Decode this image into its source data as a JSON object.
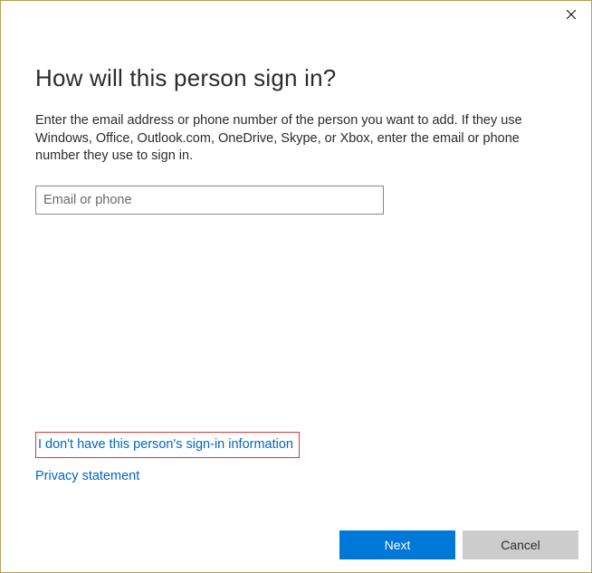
{
  "heading": "How will this person sign in?",
  "description": "Enter the email address or phone number of the person you want to add. If they use Windows, Office, Outlook.com, OneDrive, Skype, or Xbox, enter the email or phone number they use to sign in.",
  "email_input": {
    "placeholder": "Email or phone",
    "value": ""
  },
  "links": {
    "no_info": "I don't have this person's sign-in information",
    "privacy": "Privacy statement"
  },
  "buttons": {
    "next": "Next",
    "cancel": "Cancel"
  }
}
